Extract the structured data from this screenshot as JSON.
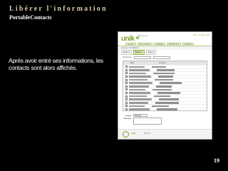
{
  "slide": {
    "title": "Libérer l'information",
    "subtitle": "PortableContacts",
    "caption": "Après avoir entré ses informations, les contacts sont alors affichés.",
    "page_number": "19"
  },
  "screenshot": {
    "logo": "unik",
    "site_tag": "Bienvenue",
    "top_links": "Mon compte | Aide",
    "nav_tabs": [
      "Accueil",
      "Mon contenu",
      "Partager",
      "Rechercher",
      "Groupes"
    ],
    "breadcrumb": "Accueil > Invitations",
    "steps": [
      "Étape 1",
      "Étape 2",
      "Étape 3"
    ],
    "search_label": "Rechercher",
    "table_headers": [
      "Nom",
      "Courriel"
    ],
    "row_count": 14,
    "form_labels": [
      "Langue",
      "Message"
    ],
    "language_value": "Français",
    "trusted_label": "TRUSTe",
    "send_label": "Envoyer",
    "bottom_brand": "unik",
    "bottom_note": "Web lab"
  },
  "colors": {
    "background": "#000000",
    "title": "#d7c9a4",
    "accent_green": "#7aa22b"
  }
}
